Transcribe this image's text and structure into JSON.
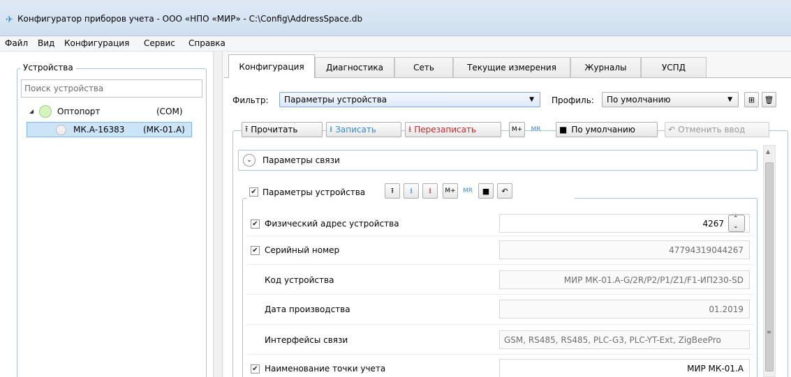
{
  "window": {
    "title": "Конфигуратор приборов учета - ООО «НПО «МИР» - C:\\Config\\AddressSpace.db"
  },
  "menu": [
    "Файл",
    "Вид",
    "Конфигурация",
    "Сервис",
    "Справка"
  ],
  "left": {
    "group_title": "Устройства",
    "search_placeholder": "Поиск устройства",
    "tree": {
      "port_name": "Оптопорт",
      "port_type": "(COM)",
      "device_name": "МК.А-16383",
      "device_model": "(МК-01.А)"
    }
  },
  "tabs": [
    "Конфигурация",
    "Диагностика",
    "Сеть",
    "Текущие измерения",
    "Журналы",
    "УСПД"
  ],
  "filter": {
    "label": "Фильтр:",
    "value": "Параметры устройства"
  },
  "profile": {
    "label": "Профиль:",
    "value": "По умолчанию"
  },
  "toolbar": {
    "read": "Прочитать",
    "write": "Записать",
    "rewrite": "Перезаписать",
    "mplus": "M+",
    "mr": "MR",
    "defaults": "По умолчанию",
    "cancel": "Отменить ввод"
  },
  "sections": {
    "comm": "Параметры связи",
    "device": "Параметры устройства"
  },
  "params": [
    {
      "label": "Физический адрес устройства",
      "value": "4267",
      "checkbox": true,
      "checked": true,
      "editable": true,
      "stepper": true
    },
    {
      "label": "Серийный номер",
      "value": "47794319044267",
      "checkbox": true,
      "checked": true,
      "editable": false
    },
    {
      "label": "Код устройства",
      "value": "МИР МК-01.А-G/2R/P2/P1/Z1/F1-ИП230-SD",
      "checkbox": false,
      "editable": false
    },
    {
      "label": "Дата производства",
      "value": "01.2019",
      "checkbox": false,
      "editable": false
    },
    {
      "label": "Интерфейсы связи",
      "value": "GSM, RS485, RS485, PLC-G3, PLC-YT-Ext, ZigBeePro",
      "checkbox": false,
      "editable": false
    },
    {
      "label": "Наименование точки учета",
      "value": "МИР МК-01.А",
      "checkbox": true,
      "checked": true,
      "editable": true
    }
  ],
  "colors": {
    "accent": "#3399ff",
    "selection": "#cce4f7",
    "border": "#a9c2e0",
    "red_icon": "#d32f2f",
    "blue_icon": "#2e8bd8",
    "status_green": "#c8f0b0"
  }
}
